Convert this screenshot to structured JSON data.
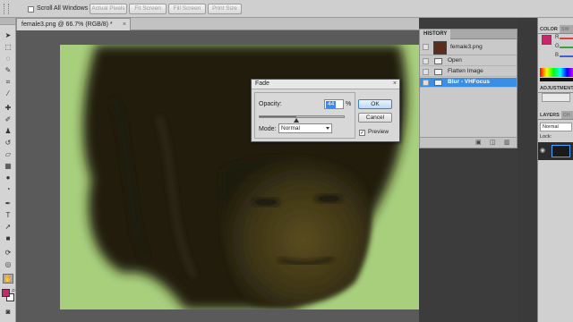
{
  "options_bar": {
    "scroll_all_windows": "Scroll All Windows",
    "actual_pixels": "Actual Pixels",
    "fit_screen": "Fit Screen",
    "fill_screen": "Fill Screen",
    "print_size": "Print Size"
  },
  "document": {
    "tab_title": "female3.png @ 66.7% (RGB/8) *",
    "close_glyph": "×"
  },
  "history": {
    "tab_label": "HISTORY",
    "snapshot_name": "female3.png",
    "states": [
      "Open",
      "Flatten Image",
      "Blur - VHFocus"
    ],
    "selected_state": "Blur - VHFocus"
  },
  "right_panels": {
    "color_tabs": [
      "COLOR",
      "SW"
    ],
    "color_letters": [
      "R",
      "G",
      "B"
    ],
    "adjustments_tab": "ADJUSTMENTS",
    "layers_tabs": [
      "LAYERS",
      "CH"
    ],
    "blend_mode": "Normal",
    "lock_label": "Lock:"
  },
  "fade_dialog": {
    "title": "Fade",
    "close_glyph": "×",
    "opacity_label": "Opacity:",
    "opacity_value": "44",
    "opacity_unit": "%",
    "opacity_level": 44,
    "mode_label": "Mode:",
    "mode_value": "Normal",
    "ok_label": "OK",
    "cancel_label": "Cancel",
    "preview_label": "Preview",
    "preview_checked": true
  },
  "colors": {
    "foreground": "#c8286b",
    "background": "#ffffff",
    "canvas_background": "#a7cf7c",
    "selection_highlight": "#3a8ee6"
  },
  "tools": [
    "move-tool-icon",
    "marquee-tool-icon",
    "lasso-tool-icon",
    "quick-selection-tool-icon",
    "crop-tool-icon",
    "eyedropper-tool-icon",
    "healing-brush-tool-icon",
    "brush-tool-icon",
    "clone-stamp-tool-icon",
    "history-brush-tool-icon",
    "eraser-tool-icon",
    "gradient-tool-icon",
    "blur-tool-icon",
    "dodge-tool-icon",
    "pen-tool-icon",
    "type-tool-icon",
    "path-selection-tool-icon",
    "shape-tool-icon",
    "3d-rotate-tool-icon",
    "3d-orbit-tool-icon",
    "hand-tool-icon",
    "zoom-tool-icon"
  ]
}
